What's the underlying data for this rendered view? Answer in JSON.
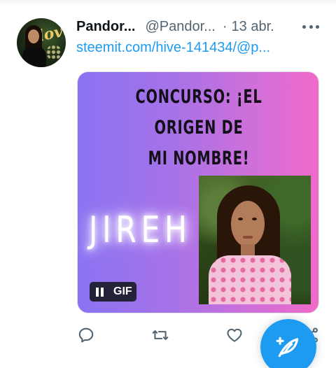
{
  "tweet": {
    "author_name": "Pandor...",
    "author_handle": "@Pandor...",
    "separator": "·",
    "date": "13 abr.",
    "link_text": "steemit.com/hive-141434/@p..."
  },
  "media": {
    "title_line1": "CONCURSO: ¡EL ORIGEN DE",
    "title_line2": "MI NOMBRE!",
    "name_text": "JIREH",
    "gif_label": "GIF"
  },
  "colors": {
    "accent": "#1d9bf0",
    "secondary_text": "#536471",
    "gradient_left": "#8a73f2",
    "gradient_right": "#f06ac8"
  },
  "icons": {
    "more": "more-horizontal-icon",
    "reply": "reply-icon",
    "retweet": "retweet-icon",
    "like": "heart-icon",
    "share": "share-icon",
    "compose": "compose-feather-icon",
    "pause": "pause-icon"
  }
}
